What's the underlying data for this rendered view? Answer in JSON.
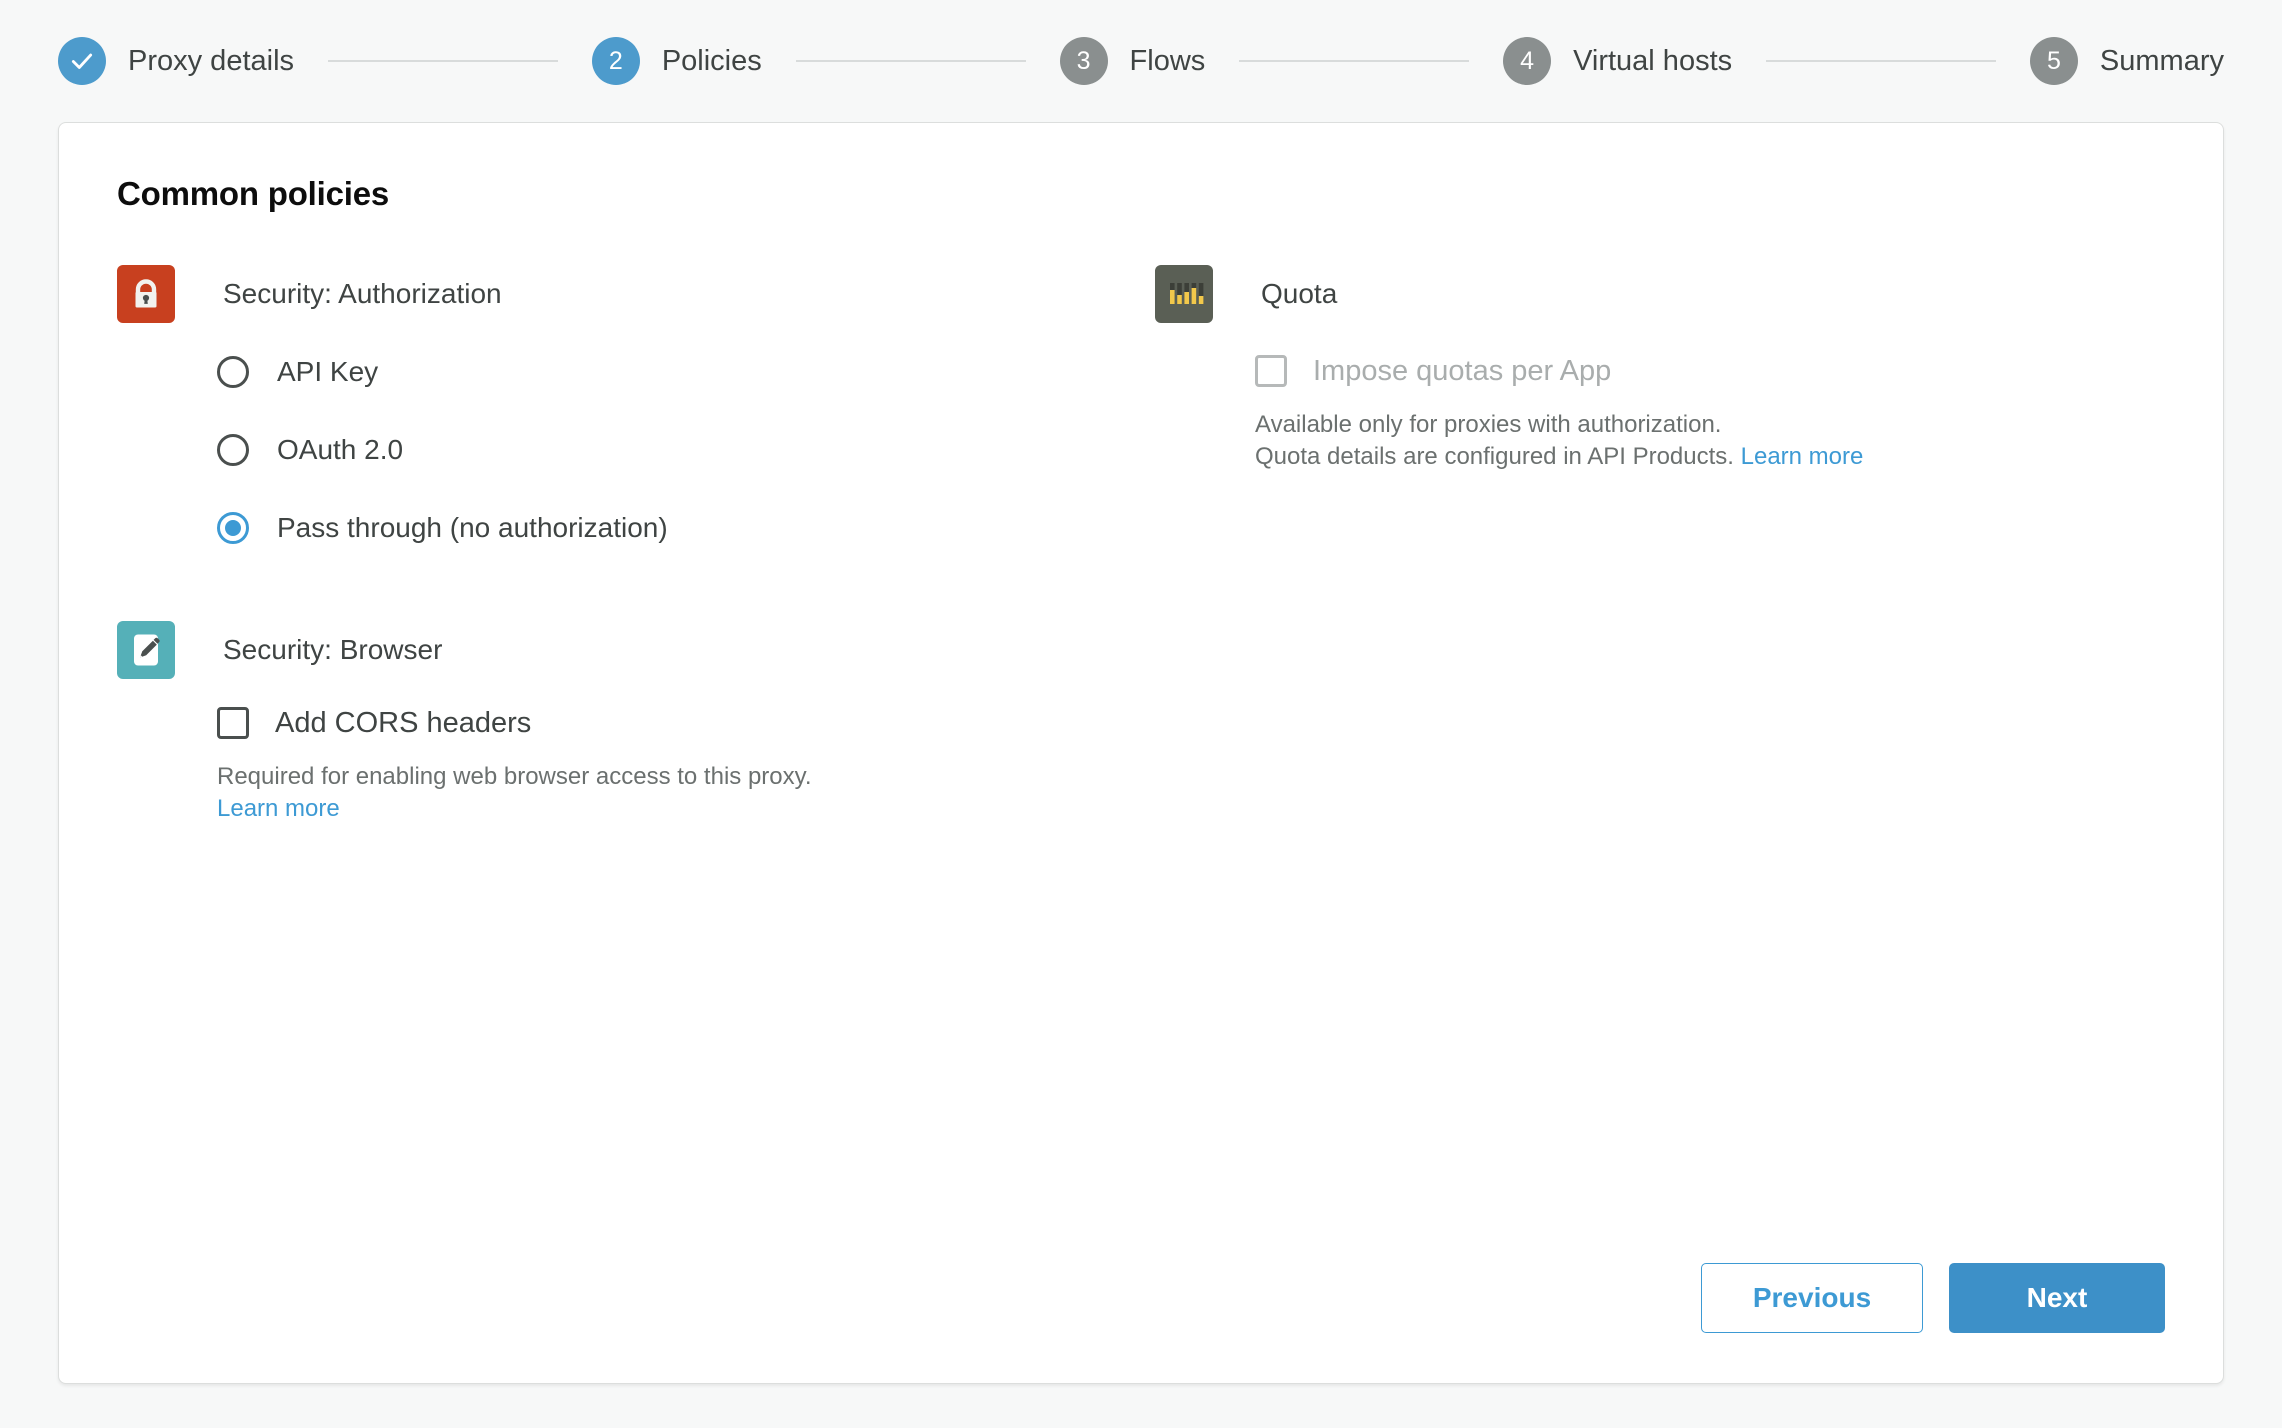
{
  "stepper": {
    "steps": [
      {
        "marker": "check-icon",
        "label": "Proxy details",
        "state": "done"
      },
      {
        "marker": "2",
        "label": "Policies",
        "state": "active"
      },
      {
        "marker": "3",
        "label": "Flows",
        "state": "todo"
      },
      {
        "marker": "4",
        "label": "Virtual hosts",
        "state": "todo"
      },
      {
        "marker": "5",
        "label": "Summary",
        "state": "todo"
      }
    ]
  },
  "card": {
    "title": "Common policies",
    "authorization": {
      "icon": "lock-icon",
      "icon_color": "#c8401f",
      "title": "Security: Authorization",
      "options": [
        {
          "label": "API Key",
          "checked": false
        },
        {
          "label": "OAuth 2.0",
          "checked": false
        },
        {
          "label": "Pass through (no authorization)",
          "checked": true
        }
      ]
    },
    "browser": {
      "icon": "pencil-icon",
      "icon_color": "#55b0b8",
      "title": "Security: Browser",
      "checkbox_label": "Add CORS headers",
      "checked": false,
      "help_text": "Required for enabling web browser access to this proxy.",
      "learn_more": "Learn more"
    },
    "quota": {
      "icon": "quota-bars-icon",
      "icon_color": "#5a5f55",
      "title": "Quota",
      "checkbox_label": "Impose quotas per App",
      "checked": false,
      "disabled": true,
      "help_line_1": "Available only for proxies with authorization.",
      "help_line_2": "Quota details are configured in API Products.",
      "learn_more": "Learn more"
    },
    "actions": {
      "previous_label": "Previous",
      "next_label": "Next"
    }
  },
  "colors": {
    "accent_blue": "#3d9ad4",
    "primary_button": "#3d90c8",
    "step_inactive": "#8a8f8f",
    "lock_red": "#c8401f",
    "browser_teal": "#55b0b8",
    "quota_dark": "#5a5f55",
    "quota_gold": "#f2c84b"
  }
}
